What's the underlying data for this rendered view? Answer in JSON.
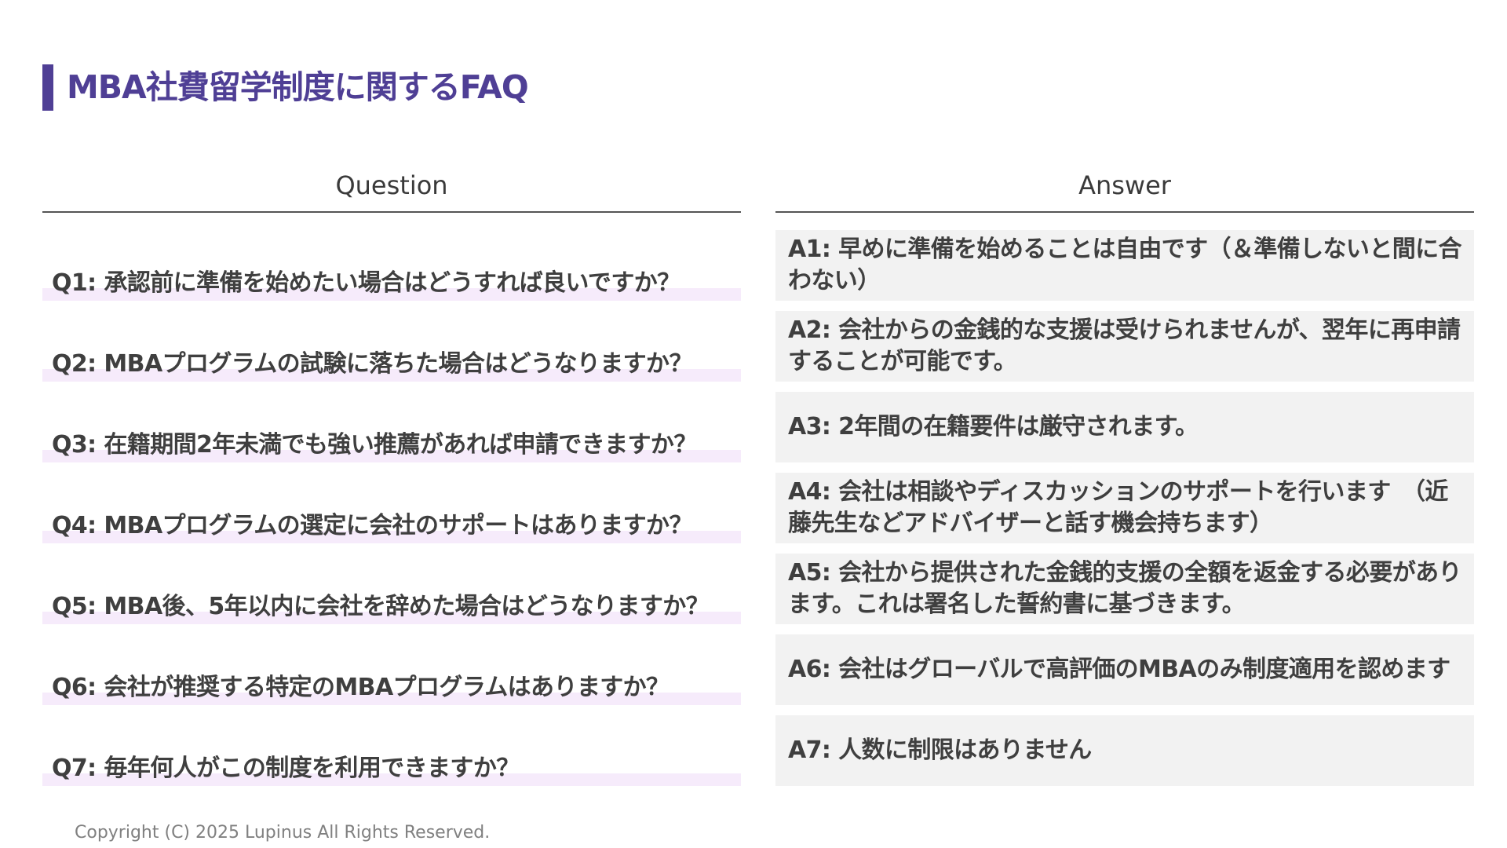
{
  "title": "MBA社費留学制度に関するFAQ",
  "headers": {
    "question": "Question",
    "answer": "Answer"
  },
  "faq": [
    {
      "q": "Q1: 承認前に準備を始めたい場合はどうすれば良いですか？",
      "a": "A1: 早めに準備を始めることは自由です（＆準備しないと間に合わない）"
    },
    {
      "q": "Q2: MBAプログラムの試験に落ちた場合はどうなりますか？",
      "a": "A2: 会社からの金銭的な支援は受けられませんが、翌年に再申請することが可能です。"
    },
    {
      "q": "Q3: 在籍期間2年未満でも強い推薦があれば申請できますか？",
      "a": "A3: 2年間の在籍要件は厳守されます。"
    },
    {
      "q": "Q4: MBAプログラムの選定に会社のサポートはありますか？",
      "a": "A4: 会社は相談やディスカッションのサポートを行います　（近藤先生などアドバイザーと話す機会持ちます）"
    },
    {
      "q": "Q5: MBA後、5年以内に会社を辞めた場合はどうなりますか？",
      "a": "A5: 会社から提供された金銭的支援の全額を返金する必要があります。これは署名した誓約書に基づきます。"
    },
    {
      "q": "Q6: 会社が推奨する特定のMBAプログラムはありますか？",
      "a": "A6: 会社はグローバルで高評価のMBAのみ制度適用を認めます"
    },
    {
      "q": "Q7: 毎年何人がこの制度を利用できますか？",
      "a": "A7: 人数に制限はありません"
    }
  ],
  "footer": {
    "copyright": "Copyright (C) 2025 Lupinus All Rights Reserved."
  },
  "colors": {
    "accent": "#4f3f95",
    "question_highlight": "#f6ebfb",
    "answer_background": "#f2f2f2",
    "text": "#3f3f3f"
  }
}
